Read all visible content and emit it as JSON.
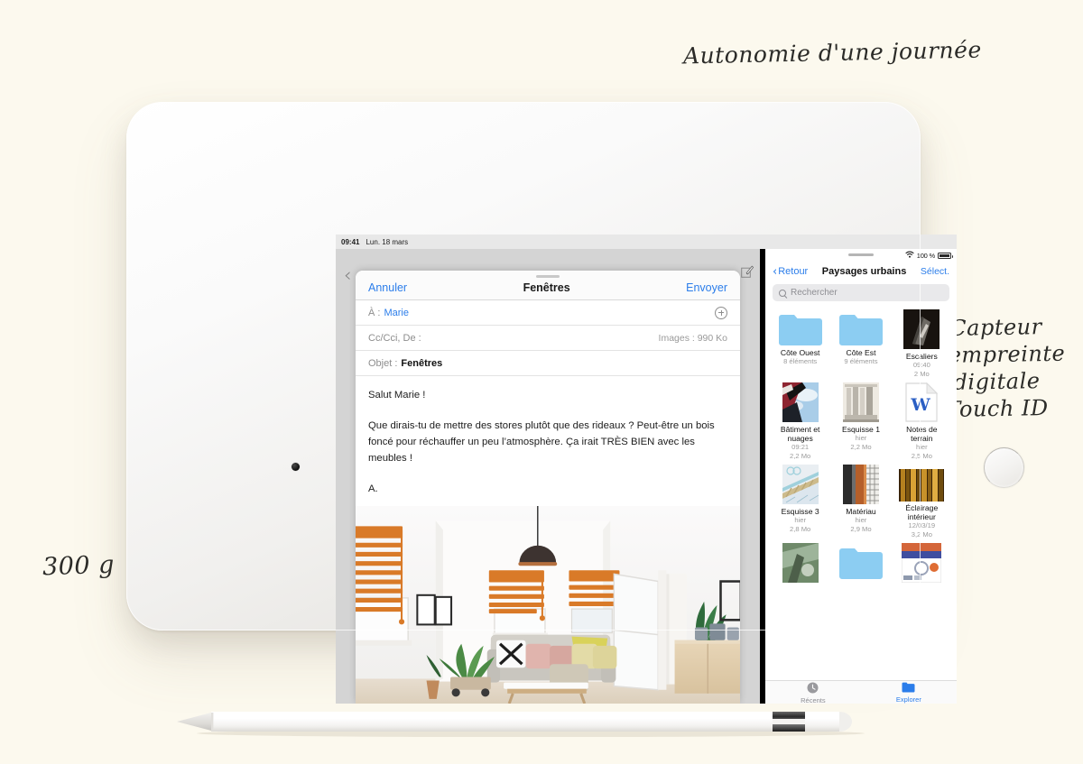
{
  "page": {
    "background_color": "#fcf9ee",
    "device": "tablet"
  },
  "annotations": {
    "top_right": "Autonomie d'une journée",
    "right_lines": [
      "Capteur",
      "d'empreinte",
      "digitale",
      "Touch ID"
    ],
    "bottom_left": "300 g"
  },
  "screen": {
    "statusbar": {
      "time": "09:41",
      "date": "Lun. 18 mars"
    },
    "mail": {
      "back_chevron": "‹",
      "compose_icon": "compose-icon",
      "navbar": {
        "cancel": "Annuler",
        "title": "Fenêtres",
        "send": "Envoyer"
      },
      "fields": {
        "to_label": "À :",
        "to_value": "Marie",
        "add_recipient_icon": "plus-circle-icon",
        "cc_label": "Cc/Cci, De :",
        "attachments": "Images : 990 Ko",
        "subject_label": "Objet :",
        "subject_value": "Fenêtres"
      },
      "body": [
        "Salut Marie !",
        "Que dirais-tu de mettre des stores plutôt que des rideaux ? Peut-être un bois foncé pour réchauffer un peu l’atmosphère. Ça irait TRÈS BIEN avec les meubles !",
        "A."
      ],
      "attachment_alt": "Photo : salon lumineux avec stores orange"
    },
    "files": {
      "statusbar": {
        "wifi_icon": "wifi-icon",
        "battery_percent": "100 %",
        "battery_icon": "battery-full-icon"
      },
      "navbar": {
        "back": "Retour",
        "title": "Paysages urbains",
        "select": "Sélect."
      },
      "search": {
        "icon": "search-icon",
        "placeholder": "Rechercher"
      },
      "items": [
        {
          "name": "Côte Ouest",
          "meta1": "8 éléments",
          "meta2": "",
          "kind": "folder"
        },
        {
          "name": "Côte Est",
          "meta1": "9 éléments",
          "meta2": "",
          "kind": "folder"
        },
        {
          "name": "Escaliers",
          "meta1": "09:40",
          "meta2": "2 Mo",
          "kind": "photo-stairs"
        },
        {
          "name": "Bâtiment et nuages",
          "meta1": "09:21",
          "meta2": "2,2 Mo",
          "kind": "photo-building"
        },
        {
          "name": "Esquisse 1",
          "meta1": "hier",
          "meta2": "2,2 Mo",
          "kind": "photo-sketch1"
        },
        {
          "name": "Notes de terrain",
          "meta1": "hier",
          "meta2": "2,5 Mo",
          "kind": "doc-word"
        },
        {
          "name": "Esquisse 3",
          "meta1": "hier",
          "meta2": "2,8 Mo",
          "kind": "photo-sketch3"
        },
        {
          "name": "Matériau",
          "meta1": "hier",
          "meta2": "2,9 Mo",
          "kind": "photo-material"
        },
        {
          "name": "Éclairage intérieur",
          "meta1": "12/03/19",
          "meta2": "3,2 Mo",
          "kind": "photo-lighting"
        },
        {
          "name": "",
          "meta1": "",
          "meta2": "",
          "kind": "photo-green"
        },
        {
          "name": "",
          "meta1": "",
          "meta2": "",
          "kind": "folder"
        },
        {
          "name": "",
          "meta1": "",
          "meta2": "",
          "kind": "doc-magazine"
        }
      ],
      "tabs": [
        {
          "label": "Récents",
          "icon": "clock-icon",
          "active": false
        },
        {
          "label": "Explorer",
          "icon": "folder-icon",
          "active": true
        }
      ]
    }
  },
  "colors": {
    "accent_blue": "#2b7dea",
    "folder_blue": "#87cbf0",
    "background": "#fcf9ee",
    "muted_gray": "#9b9b9b"
  }
}
